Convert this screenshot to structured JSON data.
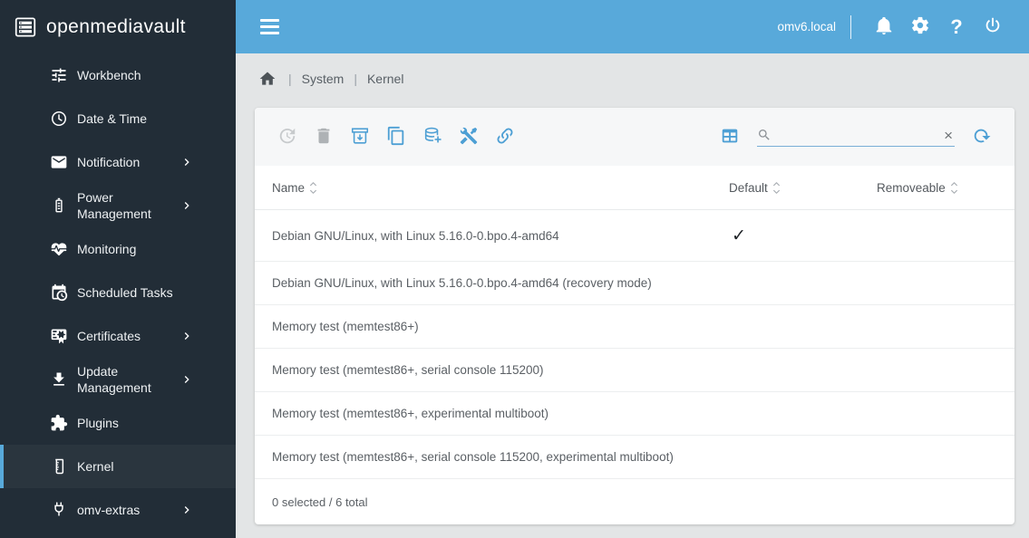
{
  "logo": {
    "text": "openmediavault"
  },
  "header": {
    "hostname": "omv6.local",
    "icons": [
      "bell-icon",
      "gear-icon",
      "help-icon",
      "power-icon"
    ],
    "help_glyph": "?"
  },
  "breadcrumb": {
    "items": [
      "System",
      "Kernel"
    ],
    "separator": "|"
  },
  "sidebar": {
    "items": [
      {
        "label": "Workbench",
        "icon": "tune",
        "expandable": false,
        "active": false
      },
      {
        "label": "Date & Time",
        "icon": "clock",
        "expandable": false,
        "active": false
      },
      {
        "label": "Notification",
        "icon": "envelope",
        "expandable": true,
        "active": false
      },
      {
        "label": "Power Management",
        "icon": "battery",
        "expandable": true,
        "active": false
      },
      {
        "label": "Monitoring",
        "icon": "heart-pulse",
        "expandable": false,
        "active": false
      },
      {
        "label": "Scheduled Tasks",
        "icon": "calendar-clock",
        "expandable": false,
        "active": false
      },
      {
        "label": "Certificates",
        "icon": "certificate",
        "expandable": true,
        "active": false
      },
      {
        "label": "Update Management",
        "icon": "download",
        "expandable": true,
        "active": false
      },
      {
        "label": "Plugins",
        "icon": "puzzle",
        "expandable": false,
        "active": false
      },
      {
        "label": "Kernel",
        "icon": "beaker",
        "expandable": false,
        "active": true
      },
      {
        "label": "omv-extras",
        "icon": "power-plug",
        "expandable": true,
        "active": false
      }
    ]
  },
  "toolbar": {
    "buttons": [
      {
        "name": "restore",
        "icon": "update",
        "enabled": false
      },
      {
        "name": "delete",
        "icon": "trash",
        "enabled": false
      },
      {
        "name": "set-default",
        "icon": "archive-arrow-down",
        "enabled": true
      },
      {
        "name": "copy",
        "icon": "content-copy",
        "enabled": true
      },
      {
        "name": "add-database",
        "icon": "database-plus",
        "enabled": true
      },
      {
        "name": "tools",
        "icon": "hammer-wrench",
        "enabled": true
      },
      {
        "name": "link",
        "icon": "link",
        "enabled": true
      }
    ],
    "search": {
      "value": "",
      "placeholder": ""
    },
    "clear_glyph": "×"
  },
  "table": {
    "columns": [
      {
        "label": "Name"
      },
      {
        "label": "Default"
      },
      {
        "label": "Removeable"
      }
    ],
    "rows": [
      {
        "name": "Debian GNU/Linux, with Linux 5.16.0-0.bpo.4-amd64",
        "default": true,
        "removeable": false
      },
      {
        "name": "Debian GNU/Linux, with Linux 5.16.0-0.bpo.4-amd64 (recovery mode)",
        "default": false,
        "removeable": false
      },
      {
        "name": "Memory test (memtest86+)",
        "default": false,
        "removeable": false
      },
      {
        "name": "Memory test (memtest86+, serial console 115200)",
        "default": false,
        "removeable": false
      },
      {
        "name": "Memory test (memtest86+, experimental multiboot)",
        "default": false,
        "removeable": false
      },
      {
        "name": "Memory test (memtest86+, serial console 115200, experimental multiboot)",
        "default": false,
        "removeable": false
      }
    ],
    "default_check_glyph": "✓",
    "footer": "0 selected / 6 total"
  },
  "colors": {
    "header_bar": "#58a9da",
    "sidebar_bg": "#222d37",
    "active_accent": "#58a9da",
    "icon_blue": "#4d9fd4",
    "content_bg": "#e3e5e6",
    "check": "#212529"
  }
}
